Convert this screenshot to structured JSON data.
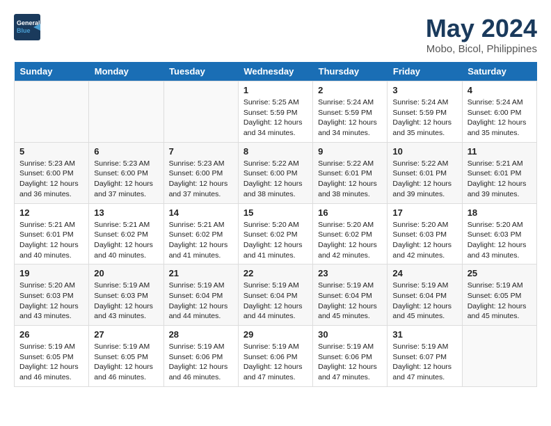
{
  "header": {
    "logo_general": "General",
    "logo_blue": "Blue",
    "month": "May 2024",
    "location": "Mobo, Bicol, Philippines"
  },
  "days_of_week": [
    "Sunday",
    "Monday",
    "Tuesday",
    "Wednesday",
    "Thursday",
    "Friday",
    "Saturday"
  ],
  "weeks": [
    [
      {
        "day": "",
        "info": ""
      },
      {
        "day": "",
        "info": ""
      },
      {
        "day": "",
        "info": ""
      },
      {
        "day": "1",
        "info": "Sunrise: 5:25 AM\nSunset: 5:59 PM\nDaylight: 12 hours\nand 34 minutes."
      },
      {
        "day": "2",
        "info": "Sunrise: 5:24 AM\nSunset: 5:59 PM\nDaylight: 12 hours\nand 34 minutes."
      },
      {
        "day": "3",
        "info": "Sunrise: 5:24 AM\nSunset: 5:59 PM\nDaylight: 12 hours\nand 35 minutes."
      },
      {
        "day": "4",
        "info": "Sunrise: 5:24 AM\nSunset: 6:00 PM\nDaylight: 12 hours\nand 35 minutes."
      }
    ],
    [
      {
        "day": "5",
        "info": "Sunrise: 5:23 AM\nSunset: 6:00 PM\nDaylight: 12 hours\nand 36 minutes."
      },
      {
        "day": "6",
        "info": "Sunrise: 5:23 AM\nSunset: 6:00 PM\nDaylight: 12 hours\nand 37 minutes."
      },
      {
        "day": "7",
        "info": "Sunrise: 5:23 AM\nSunset: 6:00 PM\nDaylight: 12 hours\nand 37 minutes."
      },
      {
        "day": "8",
        "info": "Sunrise: 5:22 AM\nSunset: 6:00 PM\nDaylight: 12 hours\nand 38 minutes."
      },
      {
        "day": "9",
        "info": "Sunrise: 5:22 AM\nSunset: 6:01 PM\nDaylight: 12 hours\nand 38 minutes."
      },
      {
        "day": "10",
        "info": "Sunrise: 5:22 AM\nSunset: 6:01 PM\nDaylight: 12 hours\nand 39 minutes."
      },
      {
        "day": "11",
        "info": "Sunrise: 5:21 AM\nSunset: 6:01 PM\nDaylight: 12 hours\nand 39 minutes."
      }
    ],
    [
      {
        "day": "12",
        "info": "Sunrise: 5:21 AM\nSunset: 6:01 PM\nDaylight: 12 hours\nand 40 minutes."
      },
      {
        "day": "13",
        "info": "Sunrise: 5:21 AM\nSunset: 6:02 PM\nDaylight: 12 hours\nand 40 minutes."
      },
      {
        "day": "14",
        "info": "Sunrise: 5:21 AM\nSunset: 6:02 PM\nDaylight: 12 hours\nand 41 minutes."
      },
      {
        "day": "15",
        "info": "Sunrise: 5:20 AM\nSunset: 6:02 PM\nDaylight: 12 hours\nand 41 minutes."
      },
      {
        "day": "16",
        "info": "Sunrise: 5:20 AM\nSunset: 6:02 PM\nDaylight: 12 hours\nand 42 minutes."
      },
      {
        "day": "17",
        "info": "Sunrise: 5:20 AM\nSunset: 6:03 PM\nDaylight: 12 hours\nand 42 minutes."
      },
      {
        "day": "18",
        "info": "Sunrise: 5:20 AM\nSunset: 6:03 PM\nDaylight: 12 hours\nand 43 minutes."
      }
    ],
    [
      {
        "day": "19",
        "info": "Sunrise: 5:20 AM\nSunset: 6:03 PM\nDaylight: 12 hours\nand 43 minutes."
      },
      {
        "day": "20",
        "info": "Sunrise: 5:19 AM\nSunset: 6:03 PM\nDaylight: 12 hours\nand 43 minutes."
      },
      {
        "day": "21",
        "info": "Sunrise: 5:19 AM\nSunset: 6:04 PM\nDaylight: 12 hours\nand 44 minutes."
      },
      {
        "day": "22",
        "info": "Sunrise: 5:19 AM\nSunset: 6:04 PM\nDaylight: 12 hours\nand 44 minutes."
      },
      {
        "day": "23",
        "info": "Sunrise: 5:19 AM\nSunset: 6:04 PM\nDaylight: 12 hours\nand 45 minutes."
      },
      {
        "day": "24",
        "info": "Sunrise: 5:19 AM\nSunset: 6:04 PM\nDaylight: 12 hours\nand 45 minutes."
      },
      {
        "day": "25",
        "info": "Sunrise: 5:19 AM\nSunset: 6:05 PM\nDaylight: 12 hours\nand 45 minutes."
      }
    ],
    [
      {
        "day": "26",
        "info": "Sunrise: 5:19 AM\nSunset: 6:05 PM\nDaylight: 12 hours\nand 46 minutes."
      },
      {
        "day": "27",
        "info": "Sunrise: 5:19 AM\nSunset: 6:05 PM\nDaylight: 12 hours\nand 46 minutes."
      },
      {
        "day": "28",
        "info": "Sunrise: 5:19 AM\nSunset: 6:06 PM\nDaylight: 12 hours\nand 46 minutes."
      },
      {
        "day": "29",
        "info": "Sunrise: 5:19 AM\nSunset: 6:06 PM\nDaylight: 12 hours\nand 47 minutes."
      },
      {
        "day": "30",
        "info": "Sunrise: 5:19 AM\nSunset: 6:06 PM\nDaylight: 12 hours\nand 47 minutes."
      },
      {
        "day": "31",
        "info": "Sunrise: 5:19 AM\nSunset: 6:07 PM\nDaylight: 12 hours\nand 47 minutes."
      },
      {
        "day": "",
        "info": ""
      }
    ]
  ]
}
